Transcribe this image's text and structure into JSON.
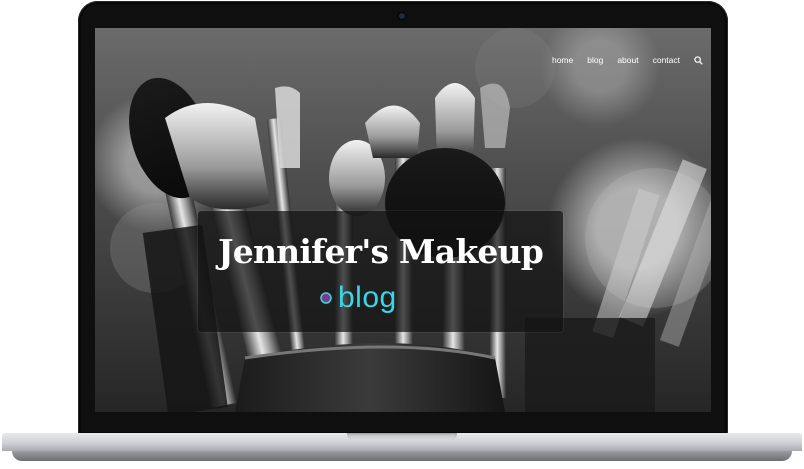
{
  "nav": {
    "items": [
      {
        "label": "home"
      },
      {
        "label": "blog"
      },
      {
        "label": "about"
      },
      {
        "label": "contact"
      }
    ],
    "search_icon": "search-icon"
  },
  "hero": {
    "title": "Jennifer's Makeup",
    "subtitle": "blog",
    "subtitle_color": "#38d6e6",
    "logo_icon": "logo-circle-icon",
    "background": "black-and-white photo of makeup brushes in a holder"
  }
}
